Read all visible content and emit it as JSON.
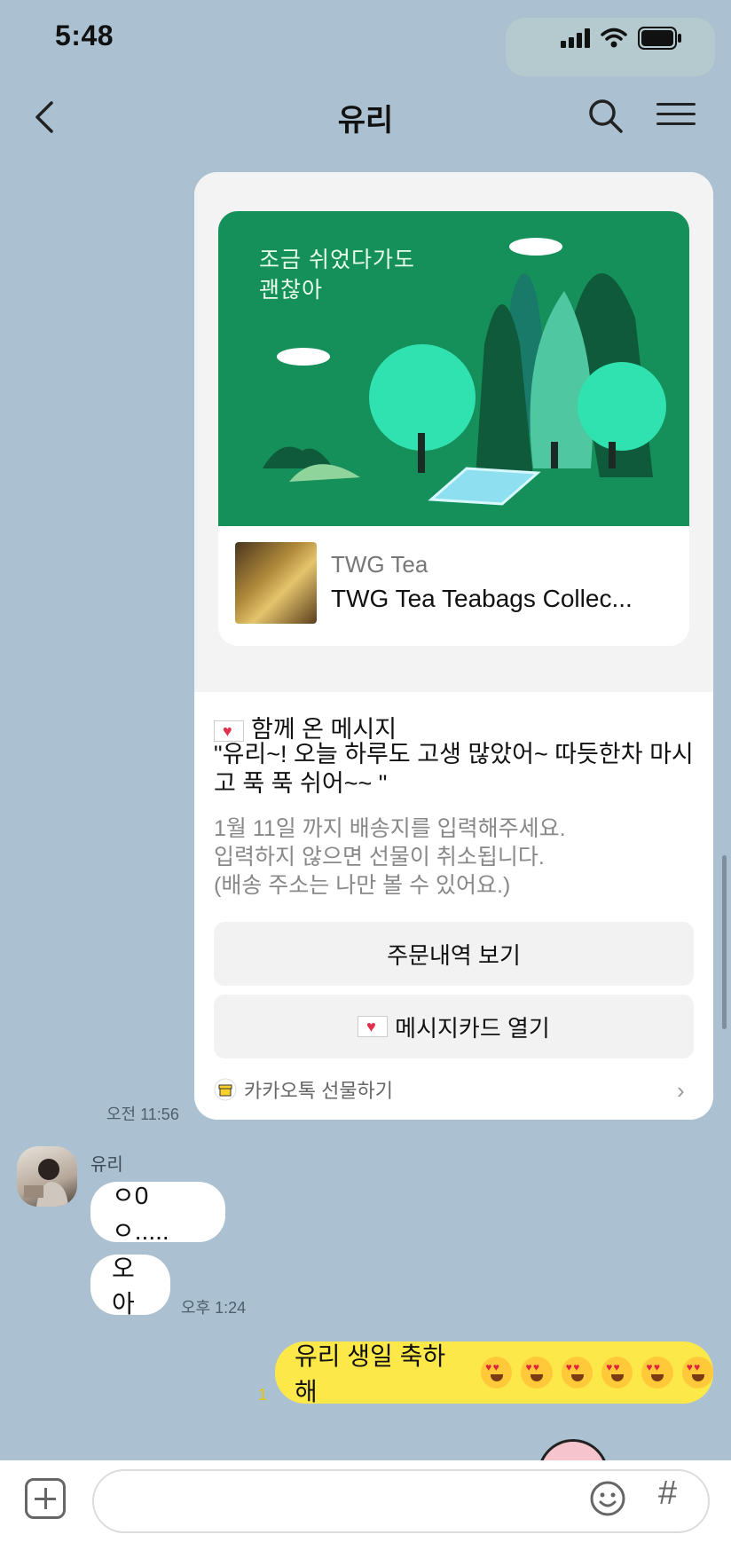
{
  "status_bar": {
    "time": "5:48"
  },
  "header": {
    "title": "유리"
  },
  "gift_card": {
    "banner_text": "조금 쉬었다가도\n괜찮아",
    "product_brand": "TWG Tea",
    "product_name": "TWG Tea Teabags Collec...",
    "message_heading": "함께 온 메시지",
    "message_text": "\"유리~! 오늘 하루도 고생 많았어~ 따듯한차 마시고 푹 푹 쉬어~~ \"",
    "notice_text": "1월 11일 까지 배송지를 입력해주세요.\n입력하지 않으면 선물이 취소됩니다.\n(배송 주소는 나만 볼 수 있어요.)",
    "order_button": "주문내역 보기",
    "message_card_button": "메시지카드 열기",
    "footer_label": "카카오톡 선물하기",
    "sent_time": "오전 11:56"
  },
  "chat": {
    "sender_name": "유리",
    "messages": [
      {
        "text": "ㅇ0ㅇ....."
      },
      {
        "text": "오아",
        "time": "오후 1:24"
      }
    ],
    "my_message": {
      "text": "유리 생일 축하해",
      "emoji_count": 6,
      "unread_count": "1"
    }
  },
  "colors": {
    "background": "#abc1d1",
    "my_bubble": "#fde84a",
    "banner": "#15905a"
  }
}
